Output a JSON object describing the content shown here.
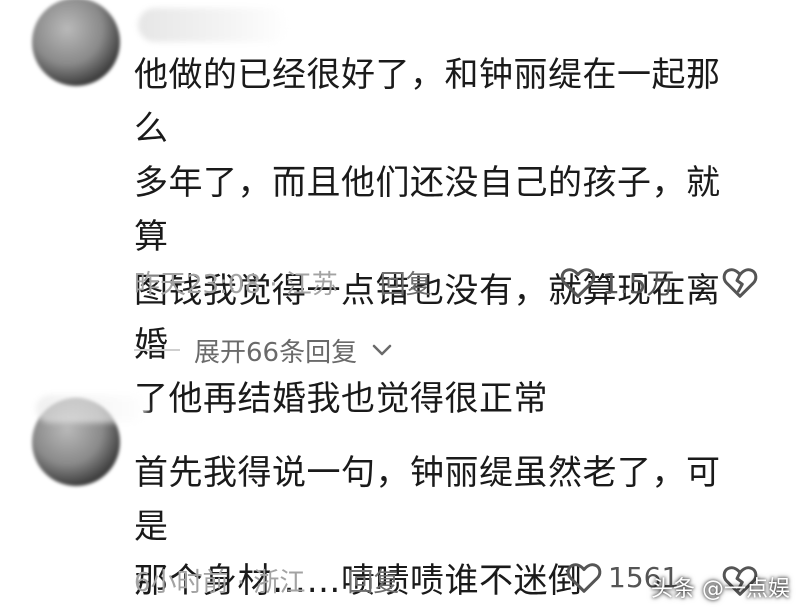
{
  "comments": [
    {
      "text_lines": [
        "他做的已经很好了，和钟丽缇在一起那么",
        "多年了，而且他们还没自己的孩子，就算",
        "图钱我觉得一点错也没有，就算现在离婚",
        "了他再结婚我也觉得很正常"
      ],
      "time_location": "昨天23:08 · 江苏",
      "reply_label": "回复",
      "like_count": "1.5万",
      "expand_label": "展开66条回复"
    },
    {
      "text_lines": [
        "首先我得说一句，钟丽缇虽然老了，可是",
        "那个身材……啧啧啧谁不迷倒"
      ],
      "time_location": "6小时前 · 浙江",
      "reply_label": "回复",
      "like_count": "1561"
    }
  ],
  "icons": {
    "like": "heart-outline-icon",
    "dislike": "broken-heart-icon",
    "expand": "chevron-down-icon"
  },
  "watermark": "头条 @一点娱"
}
